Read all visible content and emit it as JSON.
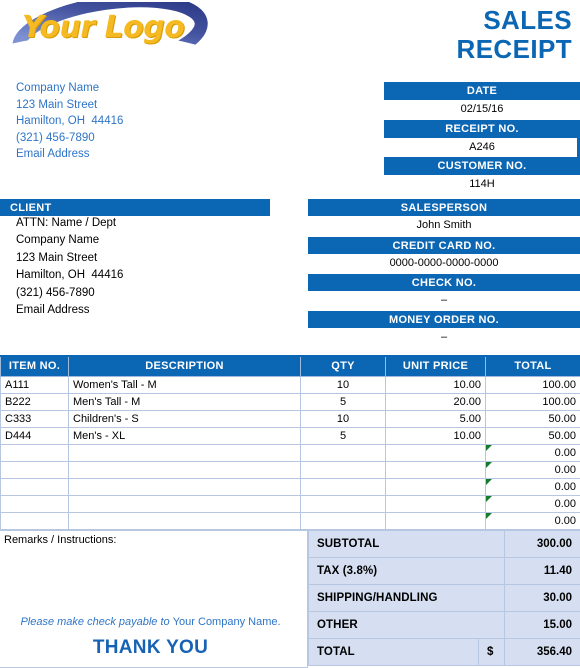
{
  "brand": {
    "logo_text": "Your Logo",
    "logo_color": "#F5B921",
    "accent_blue": "#0B66B3",
    "swoosh_dark": "#2C3E9E",
    "swoosh_light": "#A8B6E4"
  },
  "doc": {
    "title_line1": "SALES",
    "title_line2": "RECEIPT"
  },
  "seller": {
    "lines": [
      "Company Name",
      "123 Main Street",
      "Hamilton, OH  44416",
      "(321) 456-7890",
      "Email Address"
    ]
  },
  "meta": {
    "date_label": "DATE",
    "date_value": "02/15/16",
    "receipt_label": "RECEIPT NO.",
    "receipt_value": "A246",
    "customer_label": "CUSTOMER NO.",
    "customer_value": "114H"
  },
  "client": {
    "header": "CLIENT",
    "lines": [
      "ATTN: Name / Dept",
      "Company Name",
      "123 Main Street",
      "Hamilton, OH  44416",
      "(321) 456-7890",
      "Email Address"
    ]
  },
  "payment": {
    "salesperson_label": "SALESPERSON",
    "salesperson_value": "John Smith",
    "credit_card_label": "CREDIT CARD NO.",
    "credit_card_value": "0000-0000-0000-0000",
    "check_label": "CHECK NO.",
    "check_value": "–",
    "money_order_label": "MONEY ORDER NO.",
    "money_order_value": "–"
  },
  "items": {
    "columns": [
      "ITEM NO.",
      "DESCRIPTION",
      "QTY",
      "UNIT PRICE",
      "TOTAL"
    ],
    "rows": [
      {
        "item": "A111",
        "desc": "Women's Tall - M",
        "qty": "10",
        "unit": "10.00",
        "total": "100.00",
        "flag": false
      },
      {
        "item": "B222",
        "desc": "Men's Tall - M",
        "qty": "5",
        "unit": "20.00",
        "total": "100.00",
        "flag": false
      },
      {
        "item": "C333",
        "desc": "Children's - S",
        "qty": "10",
        "unit": "5.00",
        "total": "50.00",
        "flag": false
      },
      {
        "item": "D444",
        "desc": "Men's - XL",
        "qty": "5",
        "unit": "10.00",
        "total": "50.00",
        "flag": false
      },
      {
        "item": "",
        "desc": "",
        "qty": "",
        "unit": "",
        "total": "0.00",
        "flag": true
      },
      {
        "item": "",
        "desc": "",
        "qty": "",
        "unit": "",
        "total": "0.00",
        "flag": true
      },
      {
        "item": "",
        "desc": "",
        "qty": "",
        "unit": "",
        "total": "0.00",
        "flag": true
      },
      {
        "item": "",
        "desc": "",
        "qty": "",
        "unit": "",
        "total": "0.00",
        "flag": true
      },
      {
        "item": "",
        "desc": "",
        "qty": "",
        "unit": "",
        "total": "0.00",
        "flag": true
      }
    ]
  },
  "remarks": {
    "label": "Remarks / Instructions:",
    "value": "",
    "payable_italic": "Please make check payable to ",
    "payable_plain": "Your Company Name.",
    "thank_you": "THANK YOU"
  },
  "totals": {
    "rows": [
      {
        "label": "SUBTOTAL",
        "value": "300.00"
      },
      {
        "label": "TAX (3.8%)",
        "value": "11.40"
      },
      {
        "label": "SHIPPING/HANDLING",
        "value": "30.00"
      },
      {
        "label": "OTHER",
        "value": "15.00"
      }
    ],
    "grand_label": "TOTAL",
    "currency": "$",
    "grand_value": "356.40"
  }
}
